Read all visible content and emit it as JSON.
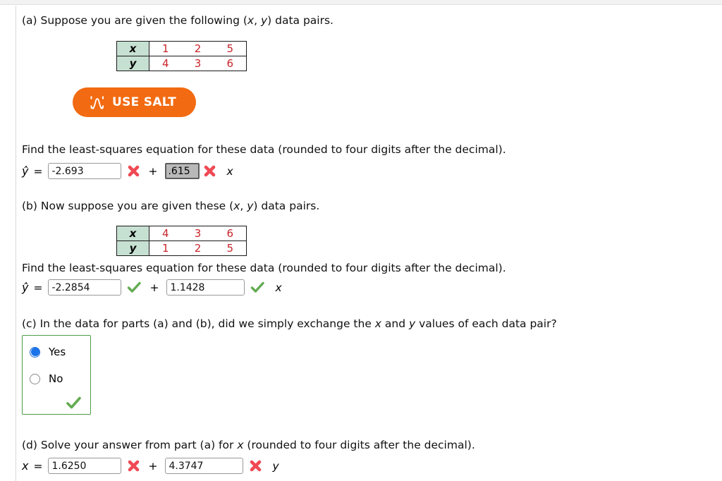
{
  "parts": {
    "a": {
      "prompt_label": "(a)",
      "prompt_text_1": "Suppose you are given the following (",
      "prompt_var_x": "x",
      "prompt_comma": ", ",
      "prompt_var_y": "y",
      "prompt_text_2": ") data pairs.",
      "table": {
        "row_x_label": "x",
        "row_y_label": "y",
        "x_values": [
          "1",
          "2",
          "5"
        ],
        "y_values": [
          "4",
          "3",
          "6"
        ]
      },
      "salt_button_label": "USE SALT",
      "find_text": "Find the least-squares equation for these data (rounded to four digits after the decimal).",
      "lhs": "ŷ",
      "equals": "=",
      "intercept_value": "-2.693",
      "intercept_status": "incorrect",
      "plus": "+",
      "slope_value": ".615",
      "slope_status": "incorrect",
      "slope_selected": true,
      "tail_variable": "x"
    },
    "b": {
      "prompt_label": "(b)",
      "prompt_text_1": "Now suppose you are given these (",
      "prompt_var_x": "x",
      "prompt_comma": ", ",
      "prompt_var_y": "y",
      "prompt_text_2": ") data pairs.",
      "table": {
        "row_x_label": "x",
        "row_y_label": "y",
        "x_values": [
          "4",
          "3",
          "6"
        ],
        "y_values": [
          "1",
          "2",
          "5"
        ]
      },
      "find_text": "Find the least-squares equation for these data (rounded to four digits after the decimal).",
      "lhs": "ŷ",
      "equals": "=",
      "intercept_value": "-2.2854",
      "intercept_status": "correct",
      "plus": "+",
      "slope_value": "1.1428",
      "slope_status": "correct",
      "tail_variable": "x"
    },
    "c": {
      "prompt_label": "(c)",
      "prompt_text_1": "In the data for parts (a) and (b), did we simply exchange the ",
      "prompt_var_x": "x",
      "prompt_text_mid": " and ",
      "prompt_var_y": "y",
      "prompt_text_2": " values of each data pair?",
      "options": [
        {
          "label": "Yes",
          "selected": true
        },
        {
          "label": "No",
          "selected": false
        }
      ],
      "status": "correct"
    },
    "d": {
      "prompt_label": "(d)",
      "prompt_text_1": "Solve your answer from part (a) for ",
      "prompt_var_x": "x",
      "prompt_text_2": " (rounded to four digits after the decimal).",
      "lhs": "x",
      "equals": "=",
      "intercept_value": "1.6250",
      "intercept_status": "incorrect",
      "plus": "+",
      "slope_value": "4.3747",
      "slope_status": "incorrect",
      "tail_variable": "y"
    }
  },
  "icons": {
    "incorrect": "x-mark-icon",
    "correct": "check-mark-icon",
    "salt": "salt-chart-icon"
  },
  "colors": {
    "salt_orange": "#f26a11",
    "table_header_green": "#c6e0d2",
    "table_value_red": "#c8252b",
    "incorrect_red": "#ef4a54",
    "correct_green": "#63ab52",
    "radio_blue": "#1a73e8",
    "correct_box_border": "#4d9b46"
  }
}
